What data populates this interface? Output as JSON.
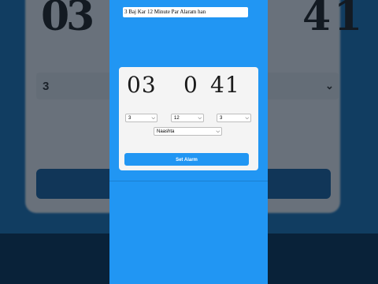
{
  "alarm_input": {
    "value": "3 Baj Kar 12 Minute Par Alaram han"
  },
  "clock": {
    "hours": "03",
    "minutes": "0",
    "seconds": "41"
  },
  "selects": {
    "hour": "3",
    "minute": "12",
    "second": "3",
    "label": "Naashta"
  },
  "actions": {
    "set_alarm": "Set Alarm"
  },
  "background": {
    "select_value": "3"
  },
  "icons": {
    "select_arrow": "chevron-down-icon"
  },
  "colors": {
    "accent": "#2196f3",
    "card": "#f4f4f4"
  }
}
